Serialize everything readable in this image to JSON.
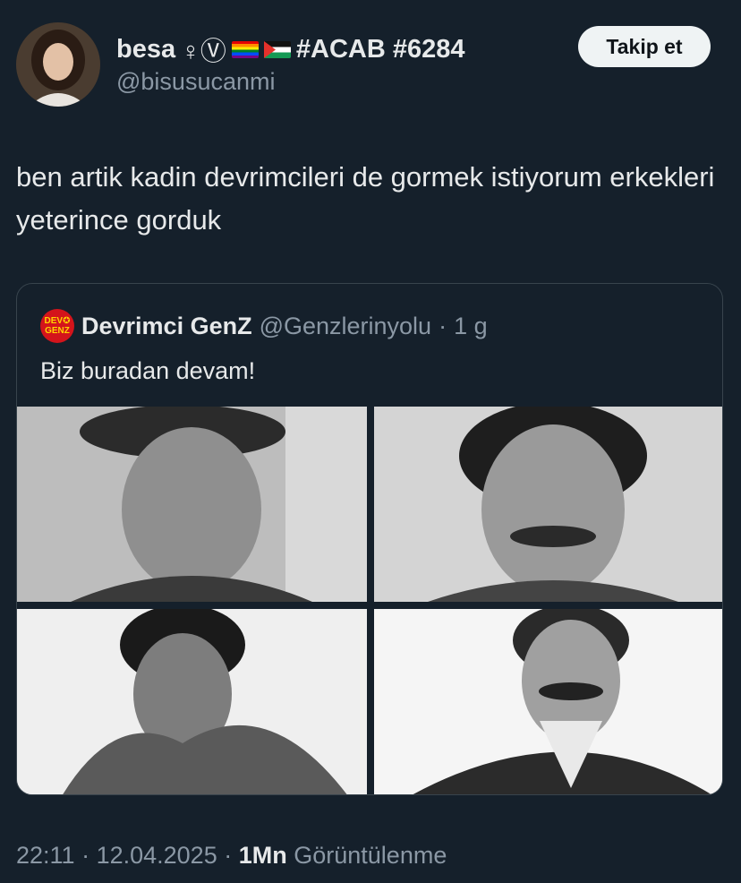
{
  "author": {
    "display_name": "besa",
    "symbols": "♀Ⓥ",
    "hashtags": "#ACAB #6284",
    "handle": "@bisusucanmi"
  },
  "follow_label": "Takip et",
  "tweet_text": "ben artik kadin devrimcileri de gormek istiyorum erkekleri yeterince gorduk",
  "quote": {
    "avatar_text_top": "DEV✪",
    "avatar_text_bottom": "GENZ",
    "name": "Devrimci GenZ",
    "handle": "@Genzlerinyolu",
    "separator": "·",
    "time": "1 g",
    "text": "Biz buradan devam!"
  },
  "footer": {
    "time": "22:11",
    "date": "12.04.2025",
    "views": "1Mn",
    "views_label": "Görüntülenme"
  },
  "colors": {
    "background": "#15202b",
    "text": "#e7e9ea",
    "secondary_text": "#8b98a5",
    "border": "#38444d",
    "button_bg": "#eff3f4"
  }
}
